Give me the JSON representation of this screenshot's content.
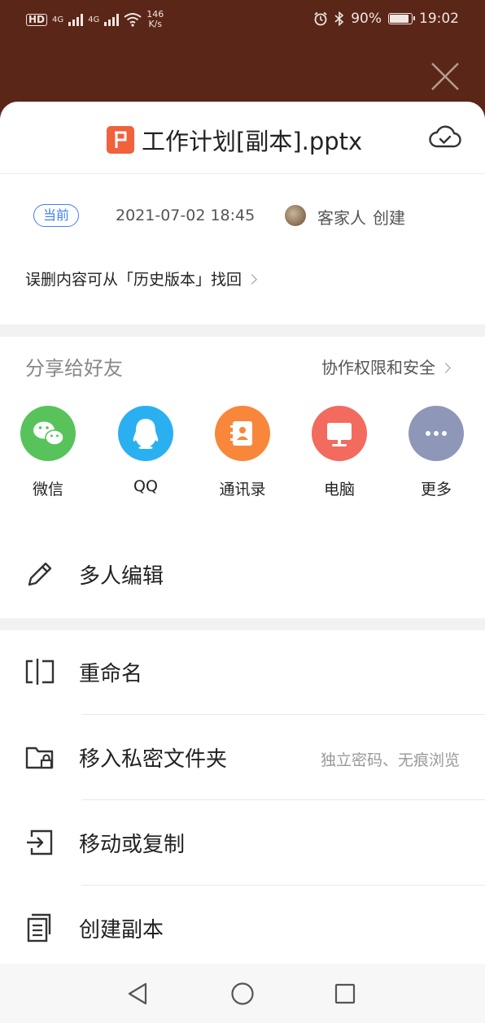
{
  "status_bar": {
    "hd": "HD",
    "signal_1": "4G",
    "signal_2": "4G",
    "speed_value": "146",
    "speed_unit": "K/s",
    "battery": "90%",
    "time": "19:02",
    "battery_level": 0.9
  },
  "file": {
    "name": "工作计划[副本].pptx",
    "icon_letter": "P",
    "icon_color": "#f0613c"
  },
  "version": {
    "current_badge": "当前",
    "date": "2021-07-02 18:45",
    "creator_name": "客家人",
    "creator_action": "创建",
    "history_hint": "误删内容可从「历史版本」找回"
  },
  "share": {
    "title": "分享给好友",
    "permissions_link": "协作权限和安全",
    "targets": [
      {
        "label": "微信",
        "icon": "wechat-icon",
        "color": "#58c35a"
      },
      {
        "label": "QQ",
        "icon": "qq-icon",
        "color": "#2ab0f0"
      },
      {
        "label": "通讯录",
        "icon": "contacts-icon",
        "color": "#f8873b"
      },
      {
        "label": "电脑",
        "icon": "computer-icon",
        "color": "#f36a5e"
      },
      {
        "label": "更多",
        "icon": "more-icon",
        "color": "#8e97b7"
      }
    ]
  },
  "actions": {
    "multi_edit": "多人编辑",
    "rename": "重命名",
    "private_folder": "移入私密文件夹",
    "private_folder_hint": "独立密码、无痕浏览",
    "move_copy": "移动或复制",
    "create_copy": "创建副本"
  },
  "colors": {
    "accent": "#3f7ef5",
    "backdrop": "#5a2618"
  }
}
